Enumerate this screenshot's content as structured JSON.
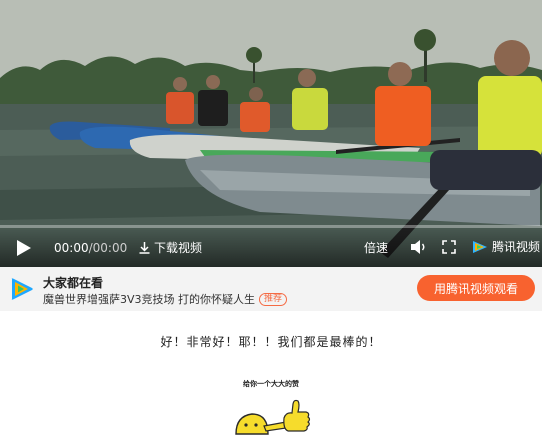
{
  "player": {
    "current_time": "00:00",
    "separator": "/",
    "duration": "00:00",
    "download_label": "下载视频",
    "speed_label": "倍速",
    "brand_label": "腾讯视频",
    "icons": [
      "play-icon",
      "download-icon",
      "volume-icon",
      "fullscreen-icon",
      "tencent-video-logo"
    ],
    "progress": 0
  },
  "promo": {
    "title": "大家都在看",
    "subtitle": "魔兽世界增强萨3V3竞技场 打的你怀疑人生",
    "tag": "推荐",
    "button_label": "用腾讯视频观看",
    "accent": "#f8622f"
  },
  "article": {
    "caption": "好！非常好！耶！！我们都是最棒的！",
    "sticker_title": "给你一个大大的赞",
    "sticker_icon": "thumbs-up-sticker"
  }
}
